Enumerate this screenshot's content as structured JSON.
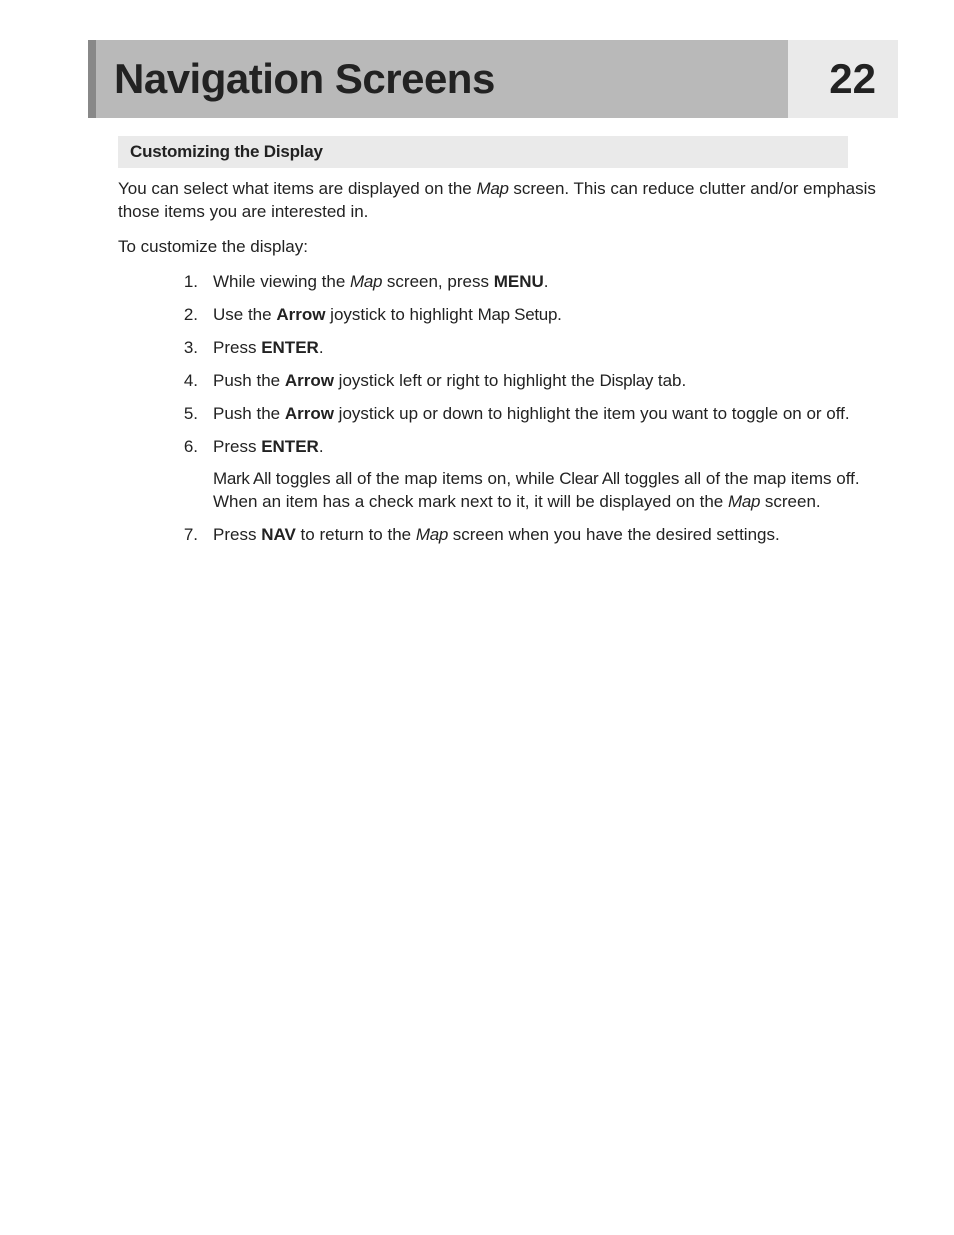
{
  "header": {
    "title": "Navigation Screens",
    "page_number": "22"
  },
  "section": {
    "subtitle": "Customizing the Display",
    "intro_1a": "You can select what items are displayed on the ",
    "intro_map": "Map",
    "intro_1b": " screen.  This can reduce clutter and/or emphasis those items you are interested in.",
    "intro_2": "To  customize the display:"
  },
  "steps": [
    {
      "num": "1.",
      "runs": [
        {
          "t": "While viewing the "
        },
        {
          "t": "Map",
          "cls": "ui it"
        },
        {
          "t": " screen, press "
        },
        {
          "t": "MENU",
          "cls": "b"
        },
        {
          "t": "."
        }
      ]
    },
    {
      "num": "2.",
      "runs": [
        {
          "t": "Use the "
        },
        {
          "t": "Arrow",
          "cls": "b"
        },
        {
          "t": " joystick to highlight "
        },
        {
          "t": "Map Setup",
          "cls": "ui"
        },
        {
          "t": "."
        }
      ]
    },
    {
      "num": "3.",
      "runs": [
        {
          "t": "Press "
        },
        {
          "t": "ENTER",
          "cls": "b"
        },
        {
          "t": "."
        }
      ]
    },
    {
      "num": "4.",
      "runs": [
        {
          "t": "Push the "
        },
        {
          "t": "Arrow",
          "cls": "b"
        },
        {
          "t": " joystick left or right to highlight the "
        },
        {
          "t": "Display",
          "cls": "ui"
        },
        {
          "t": " tab."
        }
      ]
    },
    {
      "num": "5.",
      "runs": [
        {
          "t": "Push the "
        },
        {
          "t": "Arrow",
          "cls": "b"
        },
        {
          "t": " joystick up or down to highlight the item you want to toggle on or off."
        }
      ]
    },
    {
      "num": "6.",
      "runs": [
        {
          "t": "Press "
        },
        {
          "t": "ENTER",
          "cls": "b"
        },
        {
          "t": "."
        }
      ],
      "extra": [
        {
          "t": "Mark All",
          "cls": "ui"
        },
        {
          "t": " toggles all of the map items on, while "
        },
        {
          "t": "Clear All",
          "cls": "ui"
        },
        {
          "t": " toggles all of the map items off.  When an item has a check mark next to it, it will be displayed on the "
        },
        {
          "t": "Map",
          "cls": "ui it"
        },
        {
          "t": " screen."
        }
      ]
    },
    {
      "num": "7.",
      "runs": [
        {
          "t": "Press "
        },
        {
          "t": "NAV",
          "cls": "b"
        },
        {
          "t": " to return to the "
        },
        {
          "t": "Map",
          "cls": "ui it"
        },
        {
          "t": " screen when you have the desired settings."
        }
      ]
    }
  ]
}
